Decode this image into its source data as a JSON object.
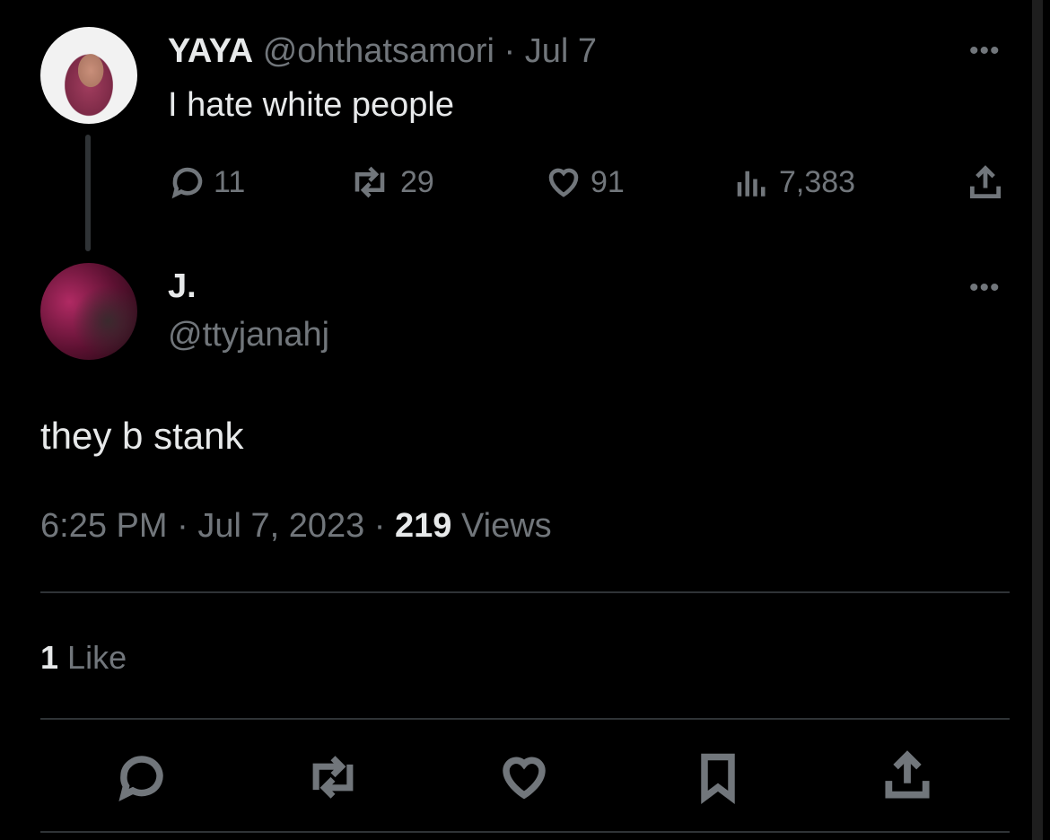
{
  "tweet1": {
    "name": "YAYA",
    "handle": "@ohthatsamori",
    "separator": "·",
    "date": "Jul 7",
    "text": "I hate white people",
    "replies": "11",
    "retweets": "29",
    "likes": "91",
    "views": "7,383"
  },
  "tweet2": {
    "name": "J.",
    "handle": "@ttyjanahj",
    "text": "they b stank",
    "time": "6:25 PM",
    "sep1": "·",
    "date": "Jul 7, 2023",
    "sep2": "·",
    "views_count": "219",
    "views_label": "Views",
    "likes_count": "1",
    "likes_label": "Like"
  },
  "more_glyph": "•••"
}
